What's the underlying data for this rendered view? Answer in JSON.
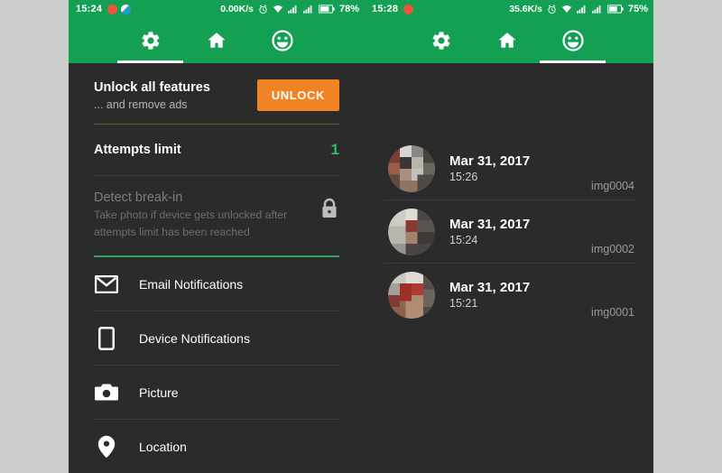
{
  "left_phone": {
    "status_bar": {
      "clock": "15:24",
      "net_speed": "0.00K/s",
      "battery": "78%",
      "icons": [
        "notification-dot-red-icon",
        "notification-dot-blue-icon",
        "alarm-icon",
        "wifi-icon",
        "signal-1-icon",
        "signal-2-icon",
        "battery-icon"
      ]
    },
    "tabs": [
      {
        "name": "settings",
        "icon": "gear-icon",
        "selected": true
      },
      {
        "name": "home",
        "icon": "home-icon",
        "selected": false
      },
      {
        "name": "face",
        "icon": "smiley-face-icon",
        "selected": false
      }
    ],
    "unlock": {
      "title": "Unlock all features",
      "subtitle": "... and remove ads",
      "button_label": "UNLOCK",
      "button_color": "#f28322"
    },
    "attempts": {
      "label": "Attempts limit",
      "value": "1",
      "value_color": "#2dbd63"
    },
    "detect": {
      "title": "Detect break-in",
      "description_line1": "Take photo if device gets unlocked after",
      "description_line2": "attempts limit has been reached",
      "icon": "lock-icon",
      "disabled": true
    },
    "menu": [
      {
        "label": "Email Notifications",
        "icon": "email-icon"
      },
      {
        "label": "Device Notifications",
        "icon": "phone-icon"
      },
      {
        "label": "Picture",
        "icon": "camera-icon"
      },
      {
        "label": "Location",
        "icon": "location-pin-icon"
      }
    ]
  },
  "right_phone": {
    "status_bar": {
      "clock": "15:28",
      "net_speed": "35.6K/s",
      "battery": "75%",
      "icons": [
        "notification-dot-red-icon",
        "alarm-icon",
        "wifi-icon",
        "signal-1-icon",
        "signal-2-icon",
        "battery-icon"
      ]
    },
    "tabs": [
      {
        "name": "settings",
        "icon": "gear-icon",
        "selected": false
      },
      {
        "name": "home",
        "icon": "home-icon",
        "selected": false
      },
      {
        "name": "face",
        "icon": "smiley-face-icon",
        "selected": true
      }
    ],
    "photos": [
      {
        "date": "Mar 31, 2017",
        "time": "15:26",
        "filename": "img0004"
      },
      {
        "date": "Mar 31, 2017",
        "time": "15:24",
        "filename": "img0002"
      },
      {
        "date": "Mar 31, 2017",
        "time": "15:21",
        "filename": "img0001"
      }
    ]
  },
  "theme": {
    "accent_green": "#13a053",
    "panel_dark": "#2b2b2b",
    "page_background": "#cccccc"
  }
}
